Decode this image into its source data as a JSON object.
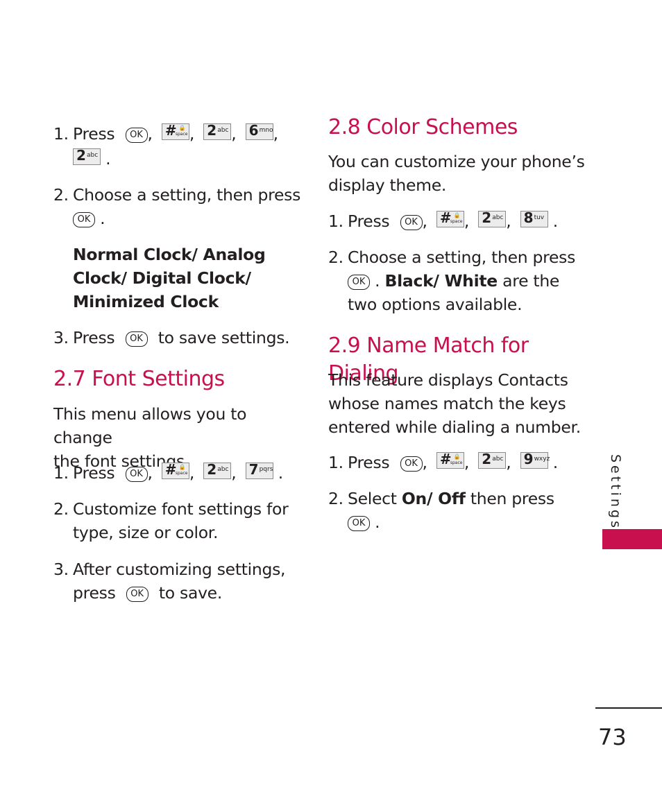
{
  "colors": {
    "accent": "#c8104e",
    "text": "#231f20",
    "key_bg": "#ececec"
  },
  "left": {
    "clock_steps": {
      "step1": {
        "num": "1.",
        "text": "Press",
        "keys": [
          "OK",
          "#",
          "2abc",
          "6mno",
          "2abc"
        ]
      },
      "step2": {
        "num": "2.",
        "text": "Choose a setting, then press"
      },
      "options": [
        "Normal Clock/ Analog",
        "Clock/ Digital Clock/",
        "Minimized Clock"
      ],
      "step3": {
        "num": "3.",
        "pre": "Press",
        "post": "to save settings."
      }
    },
    "font_settings": {
      "heading": "2.7 Font Settings",
      "intro_lines": [
        "This menu allows you to change",
        "the font settings."
      ],
      "step1": {
        "num": "1.",
        "text": "Press"
      },
      "step2": {
        "num": "2.",
        "lines": [
          "Customize font settings for",
          "type, size or color."
        ]
      },
      "step3": {
        "num": "3.",
        "line1": "After customizing settings,",
        "pre": "press",
        "post": "to save."
      }
    }
  },
  "right": {
    "color_schemes": {
      "heading": "2.8 Color Schemes",
      "intro_lines": [
        "You can customize your phone’s",
        "display theme."
      ],
      "step1": {
        "num": "1.",
        "text": "Press"
      },
      "step2": {
        "num": "2.",
        "line1": "Choose a setting, then press",
        "bold": "Black/ White",
        "after": "are the",
        "line3": "two options available."
      }
    },
    "name_match": {
      "heading": "2.9 Name Match for Dialing",
      "intro_lines": [
        "This feature displays Contacts",
        "whose names match the keys",
        "entered while dialing a number."
      ],
      "step1": {
        "num": "1.",
        "text": "Press"
      },
      "step2": {
        "num": "2.",
        "pre": "Select",
        "bold": "On/ Off",
        "post": "then press"
      }
    }
  },
  "keys": {
    "ok": "OK",
    "hash": {
      "main": "#",
      "sub": "space",
      "icon": "lock-icon"
    },
    "k2": {
      "main": "2",
      "sub": "abc"
    },
    "k6": {
      "main": "6",
      "sub": "mno"
    },
    "k7": {
      "main": "7",
      "sub": "pqrs"
    },
    "k8": {
      "main": "8",
      "sub": "tuv"
    },
    "k9": {
      "main": "9",
      "sub": "wxyz"
    }
  },
  "side_tab": {
    "label": "Settings"
  },
  "page_number": "73"
}
